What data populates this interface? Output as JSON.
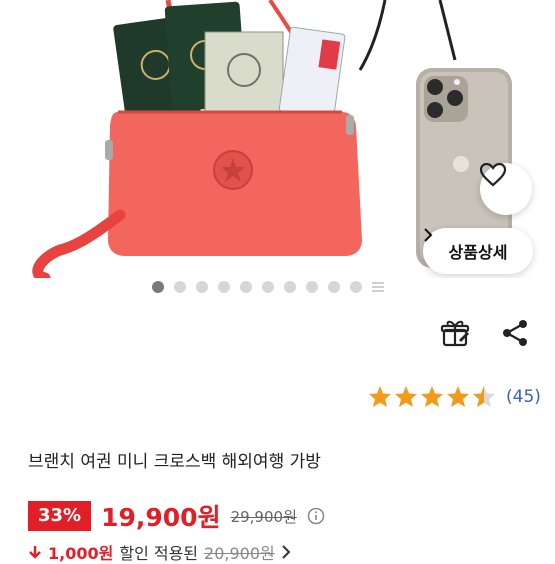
{
  "product_images": {
    "total": 11,
    "current_index": 1
  },
  "detail_button": {
    "label": "상품상세"
  },
  "rating": {
    "stars": 4.5,
    "count": "(45)"
  },
  "product": {
    "title": "브랜치 여권 미니 크로스백 해외여행 가방"
  },
  "price": {
    "discount": "33%",
    "sale": "19,900원",
    "original": "29,900원"
  },
  "coupon": {
    "amount": "1,000원",
    "text": "할인 적용된",
    "strike": "20,900원"
  },
  "colors": {
    "accent_red": "#e21f27",
    "star": "#f29a1a",
    "link_blue": "#3b5fc2",
    "bag": "#f2665d"
  }
}
